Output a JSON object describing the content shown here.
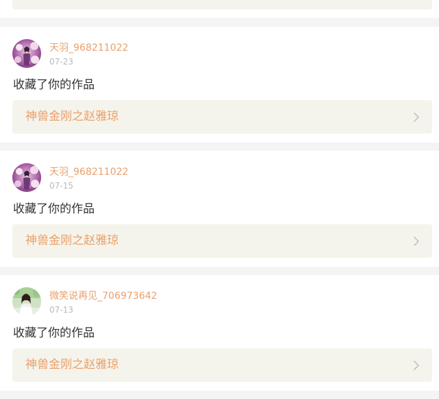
{
  "notifications": [
    {
      "username": "天羽_968211022",
      "date": "07-23",
      "action": "收藏了你的作品",
      "work_title": "神兽金刚之赵雅琼",
      "avatar_icon": "blossom-avatar"
    },
    {
      "username": "天羽_968211022",
      "date": "07-15",
      "action": "收藏了你的作品",
      "work_title": "神兽金刚之赵雅琼",
      "avatar_icon": "blossom-avatar"
    },
    {
      "username": "微笑说再见_706973642",
      "date": "07-13",
      "action": "收藏了你的作品",
      "work_title": "神兽金刚之赵雅琼",
      "avatar_icon": "girl-photo-avatar"
    }
  ],
  "colors": {
    "username": "#e9a06c",
    "work_title": "#e9a06c",
    "date": "#b9b9b9",
    "action_text": "#333333",
    "work_link_bg": "#f5f4ec",
    "page_bg": "#f4f4f4",
    "card_bg": "#ffffff"
  }
}
